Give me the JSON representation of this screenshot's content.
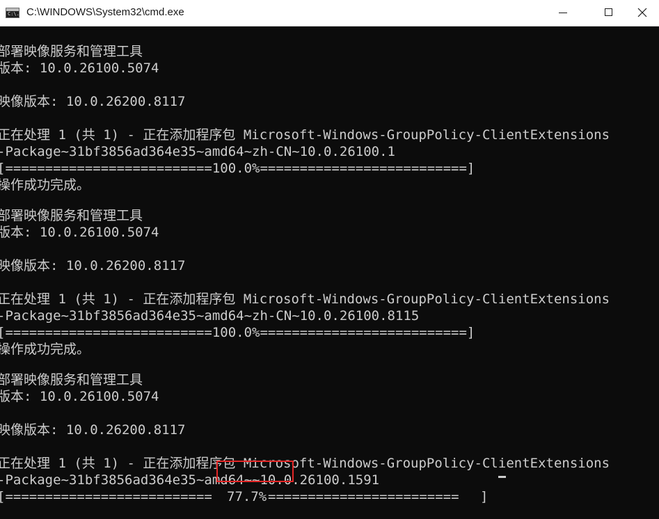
{
  "window": {
    "title": "C:\\WINDOWS\\System32\\cmd.exe",
    "icon_name": "cmd-icon",
    "icon_text": "C:\\."
  },
  "console": {
    "lines": [
      "部署映像服务和管理工具",
      "版本: 10.0.26100.5074",
      "映像版本: 10.0.26200.8117",
      "正在处理 1 (共 1) - 正在添加程序包 Microsoft-Windows-GroupPolicy-ClientExtensions",
      "-Package~31bf3856ad364e35~amd64~zh-CN~10.0.26100.1",
      "[==========================100.0%==========================]",
      "操作成功完成。",
      "部署映像服务和管理工具",
      "版本: 10.0.26100.5074",
      "映像版本: 10.0.26200.8117",
      "正在处理 1 (共 1) - 正在添加程序包 Microsoft-Windows-GroupPolicy-ClientExtensions",
      "-Package~31bf3856ad364e35~amd64~zh-CN~10.0.26100.8115",
      "[==========================100.0%==========================]",
      "操作成功完成。",
      "部署映像服务和管理工具",
      "版本: 10.0.26100.5074",
      "映像版本: 10.0.26200.8117",
      "正在处理 1 (共 1) - 正在添加程序包 Microsoft-Windows-GroupPolicy-ClientExtensions",
      "-Package~31bf3856ad364e35~amd64~~10.0.26100.1591"
    ],
    "progress": {
      "bar_left": "[==========================",
      "percent_text": "77.7%",
      "bar_after": "========================",
      "bar_right": "]",
      "percent": 77.7
    }
  },
  "colors": {
    "console_bg": "#0c0c0c",
    "console_text": "#cccccc",
    "titlebar_bg": "#ffffff",
    "highlight": "#e32626"
  }
}
